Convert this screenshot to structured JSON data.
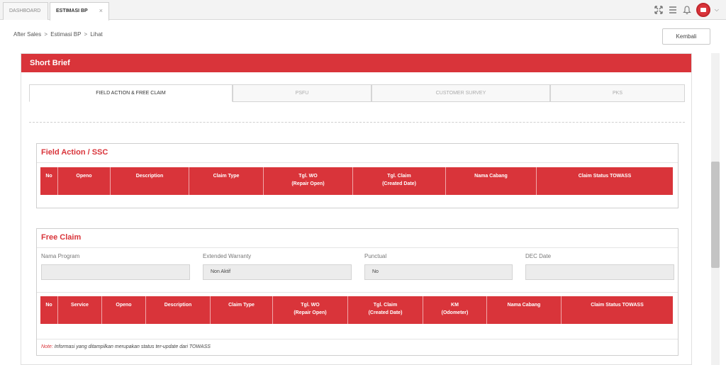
{
  "tabs": [
    {
      "label": "DASHBOARD",
      "active": false
    },
    {
      "label": "ESTIMASI BP",
      "active": true,
      "close": "×"
    }
  ],
  "topbar_icons": [
    "expand-icon",
    "menu-icon",
    "bell-icon",
    "avatar",
    "chevron-down-icon"
  ],
  "breadcrumb": [
    "After Sales",
    "Estimasi BP",
    "Lihat"
  ],
  "breadcrumb_sep": ">",
  "kembali_label": "Kembali",
  "card_title": "Short Brief",
  "inner_tabs": [
    {
      "label": "FIELD ACTION & FREE CLAIM",
      "active": true
    },
    {
      "label": "PSFU",
      "active": false
    },
    {
      "label": "CUSTOMER SURVEY",
      "active": false
    },
    {
      "label": "PKS",
      "active": false
    }
  ],
  "field_action": {
    "title": "Field Action / SSC",
    "columns": [
      "No",
      "Openo",
      "Description",
      "Claim Type",
      "Tgl. WO\n(Repair Open)",
      "Tgl. Claim\n(Created Date)",
      "Nama Cabang",
      "Claim Status TOWASS"
    ]
  },
  "free_claim": {
    "title": "Free Claim",
    "fields": [
      {
        "label": "Nama Program",
        "value": ""
      },
      {
        "label": "Extended Warranty",
        "value": "Non Aktif"
      },
      {
        "label": "Punctual",
        "value": "No"
      },
      {
        "label": "DEC Date",
        "value": ""
      }
    ],
    "columns": [
      "No",
      "Service",
      "Openo",
      "Description",
      "Claim Type",
      "Tgl. WO\n(Repair Open)",
      "Tgl. Claim\n(Created Date)",
      "KM\n(Odometer)",
      "Nama Cabang",
      "Claim Status TOWASS"
    ],
    "note_label": "Note:",
    "note_text": "Informasi yang ditampilkan merupakan status ter-update dari TOWASS"
  },
  "colors": {
    "accent": "#d9343a",
    "border": "#cfcfcf",
    "input_bg": "#ececec"
  }
}
